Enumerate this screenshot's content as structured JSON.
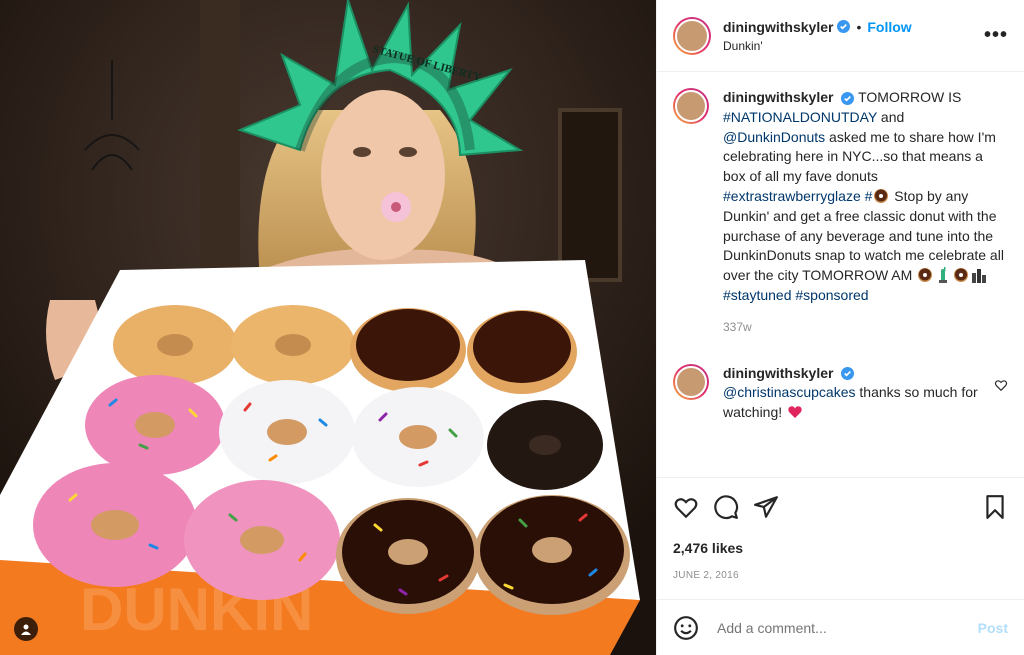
{
  "post": {
    "username": "diningwithskyler",
    "location": "Dunkin'",
    "follow_label": "Follow",
    "more_label": "•••",
    "dot": "•"
  },
  "photo": {
    "crown_text": "STATUE OF LIBERTY",
    "box_text": "DUNKIN"
  },
  "caption": {
    "username": "diningwithskyler",
    "segments": [
      {
        "t": "TOMORROW IS ",
        "k": "text"
      },
      {
        "t": "#NATIONALDONUTDAY",
        "k": "tag"
      },
      {
        "t": " and ",
        "k": "text"
      },
      {
        "t": "@DunkinDonuts",
        "k": "tag"
      },
      {
        "t": " asked me to share how I'm celebrating here in NYC...so that means a box of all my fave donuts ",
        "k": "text"
      },
      {
        "t": "#extrastrawberryglaze",
        "k": "tag"
      },
      {
        "t": " ",
        "k": "text"
      },
      {
        "t": "#",
        "k": "tag"
      },
      {
        "t": "donut",
        "k": "emoji"
      },
      {
        "t": " Stop by any Dunkin' and get a free classic donut with the purchase of any beverage and tune into the DunkinDonuts snap to watch me celebrate all over the city TOMORROW AM ",
        "k": "text"
      },
      {
        "t": "donut",
        "k": "emoji"
      },
      {
        "t": "statue",
        "k": "emoji"
      },
      {
        "t": "donut",
        "k": "emoji"
      },
      {
        "t": "city",
        "k": "emoji"
      },
      {
        "t": " ",
        "k": "text"
      },
      {
        "t": "#staytuned",
        "k": "tag"
      },
      {
        "t": " ",
        "k": "text"
      },
      {
        "t": "#sponsored",
        "k": "tag"
      }
    ],
    "time": "337w"
  },
  "reply": {
    "username": "diningwithskyler",
    "mention": "@christinascupcakes",
    "text": " thanks so much for watching! ",
    "emoji": "heart"
  },
  "actions": {
    "likes": "2,476 likes",
    "date": "JUNE 2, 2016"
  },
  "comment_box": {
    "placeholder": "Add a comment...",
    "post_label": "Post"
  },
  "colors": {
    "link": "#00376b",
    "follow": "#0095f6",
    "muted": "#8e8e8e",
    "crown": "#2fc78e",
    "box": "#f47a20"
  }
}
